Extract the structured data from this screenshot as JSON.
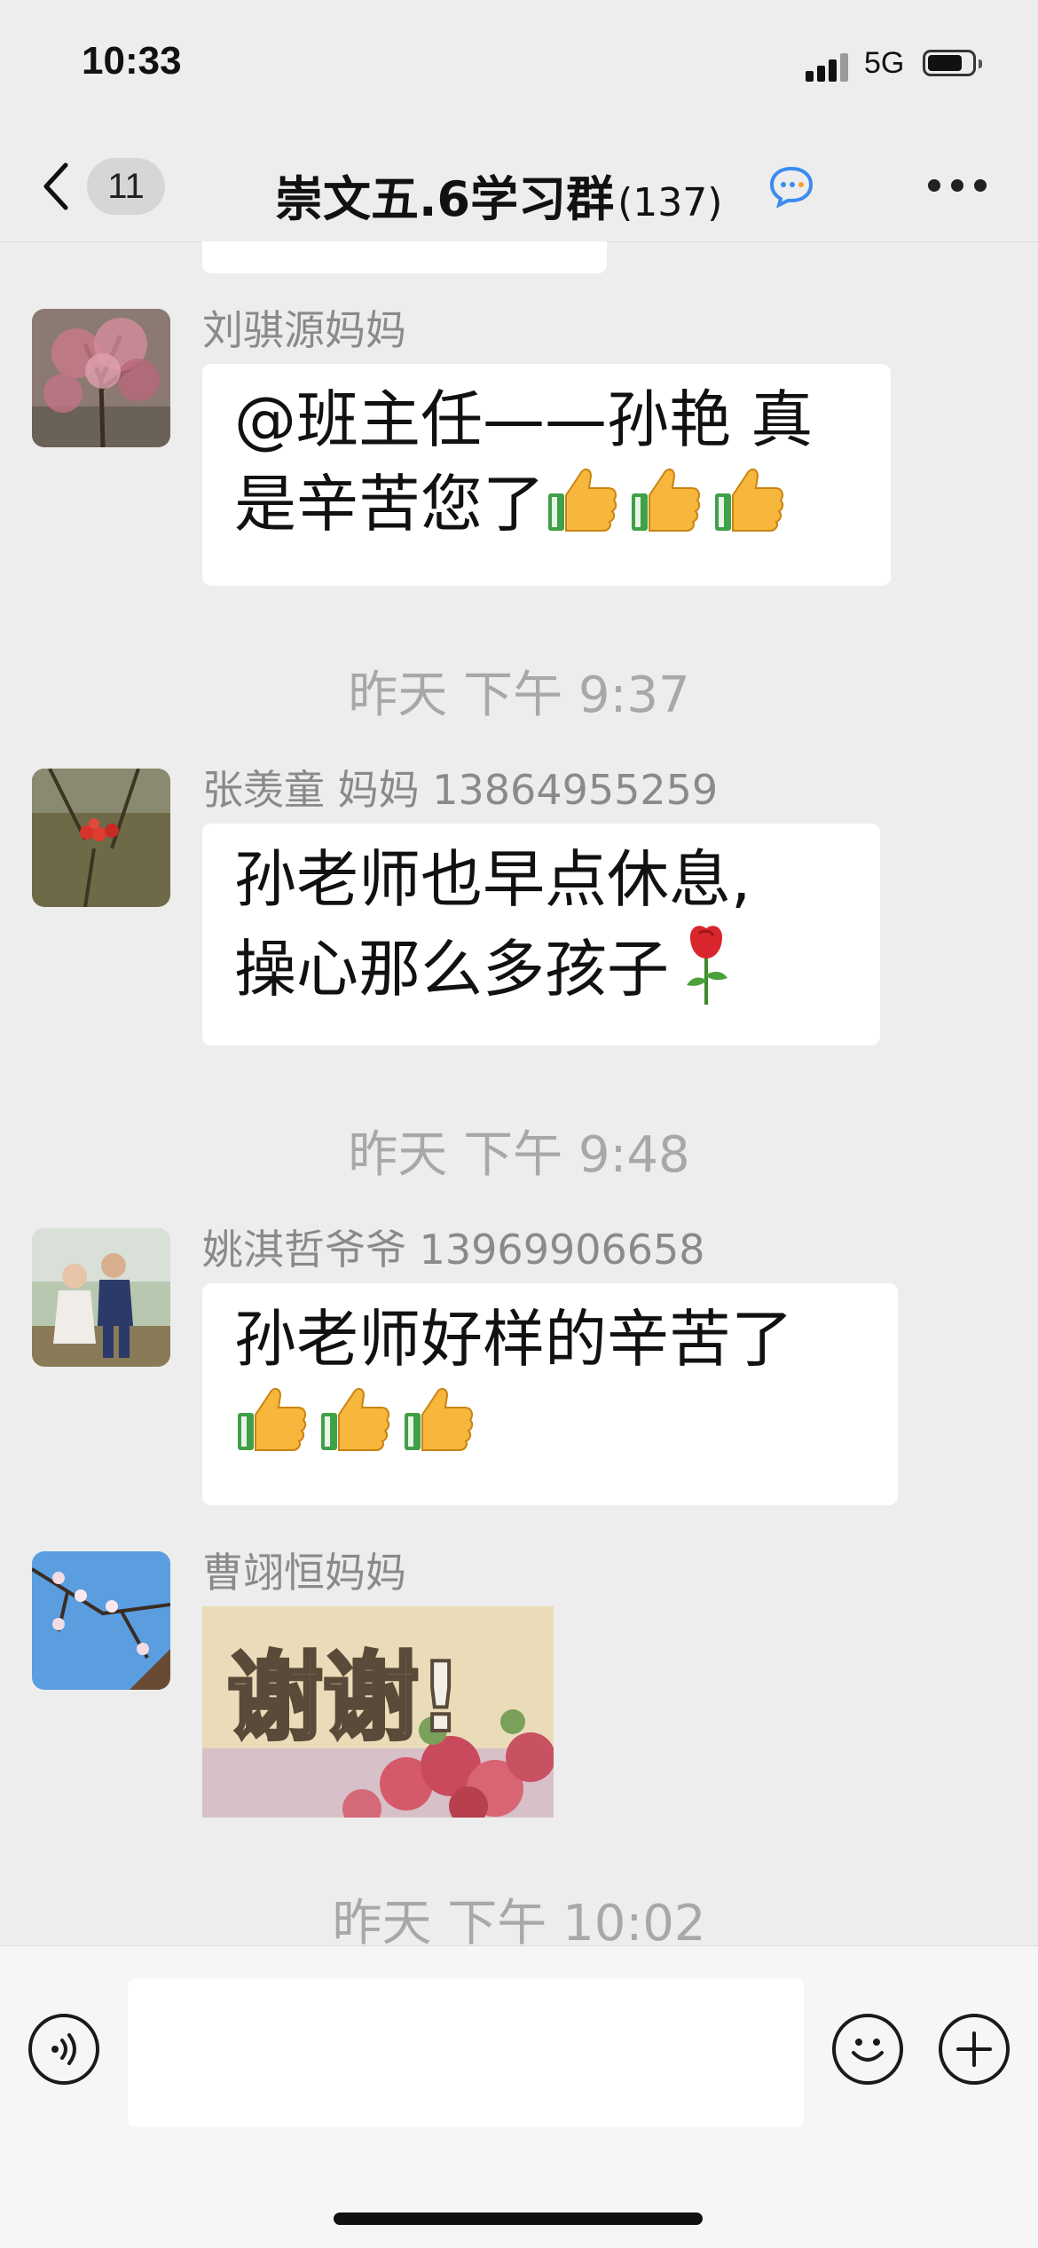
{
  "status_bar": {
    "time": "10:33",
    "network": "5G"
  },
  "header": {
    "back_count": "11",
    "title": "崇文五.6学习群",
    "member_count": "(137)"
  },
  "messages": [
    {
      "sender": "刘骐源妈妈",
      "lines": [
        "@班主任——孙艳 真",
        "是辛苦您了"
      ],
      "emoji": [
        "thumbs-up",
        "thumbs-up",
        "thumbs-up"
      ]
    },
    {
      "timestamp": "昨天 下午 9:37"
    },
    {
      "sender": "张羡童 妈妈 13864955259",
      "lines": [
        "孙老师也早点休息,",
        "操心那么多孩子"
      ],
      "emoji": [
        "rose"
      ]
    },
    {
      "timestamp": "昨天 下午 9:48"
    },
    {
      "sender": "姚淇哲爷爷 13969906658",
      "lines": [
        "孙老师好样的辛苦了"
      ],
      "emoji": [
        "thumbs-up",
        "thumbs-up",
        "thumbs-up"
      ]
    },
    {
      "sender": "曹翊恒妈妈",
      "sticker_text": "谢谢!"
    },
    {
      "timestamp": "昨天 下午 10:02"
    }
  ],
  "input_bar": {
    "placeholder": ""
  },
  "colors": {
    "background": "#ededed",
    "bubble": "#ffffff",
    "meta_text": "#a8a8a8",
    "sender_text": "#8a8a8a"
  },
  "icons": [
    "back-chevron-icon",
    "assistant-chat-icon",
    "more-icon",
    "voice-icon",
    "emoji-icon",
    "plus-icon"
  ]
}
